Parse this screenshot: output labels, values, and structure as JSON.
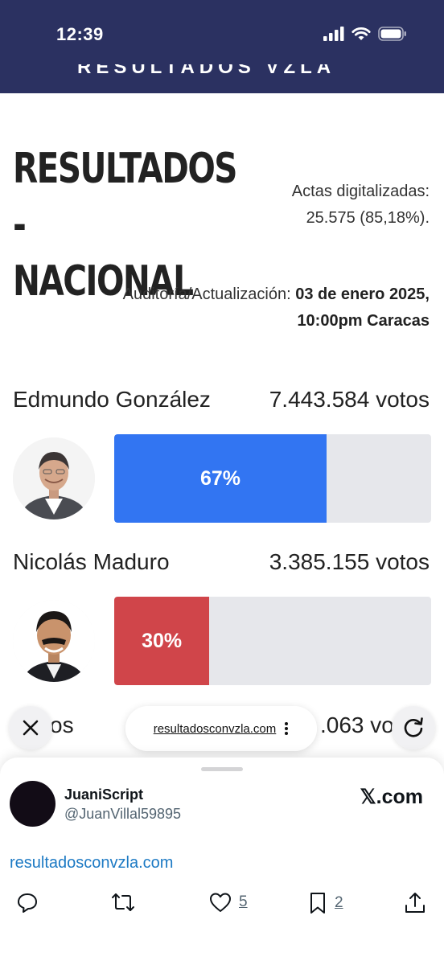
{
  "status_bar": {
    "time": "12:39"
  },
  "site_header": {
    "banner": "RESULTADOS VZLA"
  },
  "page": {
    "title_line1": "RESULTADOS -",
    "title_line2": "NACIONAL",
    "actas_label": "Actas digitalizadas:",
    "actas_value": "25.575 (85,18%).",
    "audit_label": "Auditoría/Actualización:",
    "audit_date": "03 de enero 2025,",
    "audit_time": "10:00pm Caracas"
  },
  "candidates": [
    {
      "name": "Edmundo González",
      "votes": "7.443.584 votos",
      "percent_label": "67%",
      "percent": 67,
      "color": "#3275f2"
    },
    {
      "name": "Nicolás Maduro",
      "votes": "3.385.155 votos",
      "percent_label": "30%",
      "percent": 30,
      "color": "#d0454a"
    }
  ],
  "third_row": {
    "name_partial": "os",
    "votes_partial": ".063 vo"
  },
  "browser": {
    "url": "resultadosconvzla.com",
    "close_icon": "close-icon",
    "more_icon": "vertical-dots-icon",
    "reload_icon": "reload-icon"
  },
  "tweet": {
    "display_name": "JuaniScript",
    "handle": "@JuanVillal59895",
    "source": "𝕏.com",
    "link": "resultadosconvzla.com",
    "likes": "5",
    "bookmarks": "2"
  }
}
